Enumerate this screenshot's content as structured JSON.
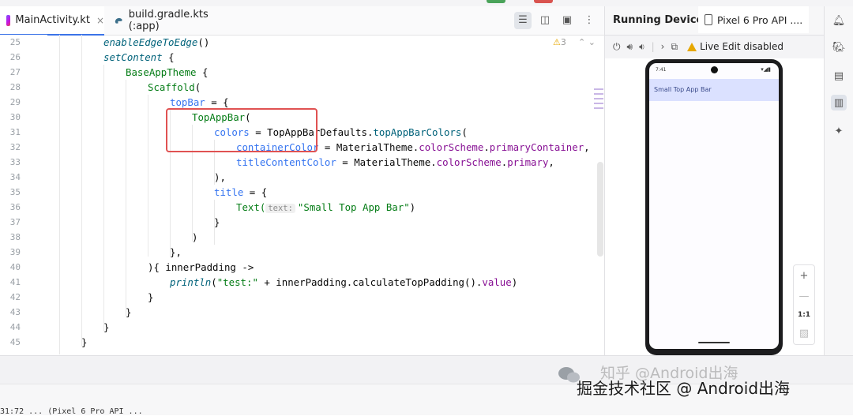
{
  "editor": {
    "tabs": [
      {
        "label": "MainActivity.kt",
        "active": true,
        "close": "×"
      },
      {
        "label": "build.gradle.kts (:app)",
        "active": false
      }
    ],
    "warnings": "3",
    "line_numbers": [
      "25",
      "26",
      "27",
      "28",
      "29",
      "30",
      "31",
      "32",
      "33",
      "34",
      "35",
      "36",
      "37",
      "38",
      "39",
      "40",
      "41",
      "42",
      "43",
      "44",
      "45"
    ],
    "code": {
      "l25": "enableEdgeToEdge",
      "l25_rest": "()",
      "l26": "setContent",
      "l26_rest": " {",
      "l27": "BaseAppTheme",
      "l27_rest": " {",
      "l28": "Scaffold",
      "l28_rest": "(",
      "l29": "topBar",
      "l29_rest": " = {",
      "l30": "TopAppBar",
      "l30_rest": "(",
      "l31a": "colors",
      "l31b": " = TopAppBarDefaults.",
      "l31c": "topAppBarColors",
      "l31d": "(",
      "l32a": "containerColor",
      "l32b": " = MaterialTheme.",
      "l32c": "colorScheme",
      "l32d": ".",
      "l32e": "primaryContainer",
      "l32f": ",",
      "l33a": "titleContentColor",
      "l33b": " = MaterialTheme.",
      "l33c": "colorScheme",
      "l33d": ".",
      "l33e": "primary",
      "l33f": ",",
      "l34": "),",
      "l35a": "title",
      "l35b": " = {",
      "l36a": "Text(",
      "l36hint": "text:",
      "l36str": "\"Small Top App Bar\"",
      "l36end": ")",
      "l37": "}",
      "l38": ")",
      "l39": "},",
      "l40": "){ innerPadding ->",
      "l41a": "println",
      "l41b": "(",
      "l41c": "\"test:\"",
      "l41d": " + innerPadding.calculateTopPadding().",
      "l41e": "value",
      "l41f": ")",
      "l42": "}",
      "l43": "}",
      "l44": "}",
      "l45": "}"
    }
  },
  "running_devices": {
    "title": "Running Devices",
    "device_tab": "Pixel 6 Pro API ....",
    "live_edit": "Live Edit disabled",
    "phone": {
      "time": "7:41",
      "appbar_title": "Small Top App Bar"
    },
    "zoom": {
      "plus": "+",
      "minus": "—",
      "one_to_one": "1:1"
    }
  },
  "watermark": {
    "line1": "知乎 @Android出海",
    "line2": "掘金技术社区 @ Android出海"
  },
  "status": "31:72  ...  (Pixel 6 Pro API ..."
}
